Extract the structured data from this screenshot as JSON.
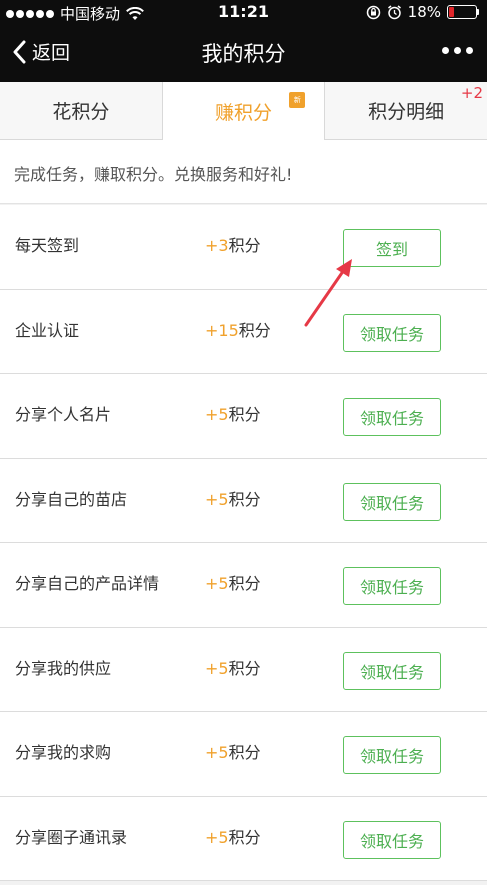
{
  "status_bar": {
    "carrier": "中国移动",
    "time": "11:21",
    "battery_percent": "18%",
    "battery_level": 0.18,
    "battery_color": "#e0262a",
    "icons": [
      "signal-dots-icon",
      "wifi-icon",
      "rotation-lock-icon",
      "alarm-icon",
      "battery-icon"
    ]
  },
  "nav": {
    "back_label": "返回",
    "title": "我的积分",
    "icons": [
      "chevron-left-icon",
      "more-icon"
    ]
  },
  "tabs": [
    {
      "label": "花积分",
      "active": false
    },
    {
      "label": "赚积分",
      "active": true,
      "badge": "新"
    },
    {
      "label": "积分明细",
      "active": false,
      "badge": "+2"
    }
  ],
  "intro": "完成任务，赚取积分。兑换服务和好礼!",
  "tasks": [
    {
      "name": "每天签到",
      "points": "+3",
      "unit": "积分",
      "button": "签到"
    },
    {
      "name": "企业认证",
      "points": "+15",
      "unit": "积分",
      "button": "领取任务"
    },
    {
      "name": "分享个人名片",
      "points": "+5",
      "unit": "积分",
      "button": "领取任务"
    },
    {
      "name": "分享自己的苗店",
      "points": "+5",
      "unit": "积分",
      "button": "领取任务"
    },
    {
      "name": "分享自己的产品详情",
      "points": "+5",
      "unit": "积分",
      "button": "领取任务"
    },
    {
      "name": "分享我的供应",
      "points": "+5",
      "unit": "积分",
      "button": "领取任务"
    },
    {
      "name": "分享我的求购",
      "points": "+5",
      "unit": "积分",
      "button": "领取任务"
    },
    {
      "name": "分享圈子通讯录",
      "points": "+5",
      "unit": "积分",
      "button": "领取任务"
    }
  ],
  "colors": {
    "accent": "#f0a12c",
    "button_green": "#4caf50",
    "annotation_red": "#e63946",
    "nav_bg": "#0d0d0d"
  }
}
